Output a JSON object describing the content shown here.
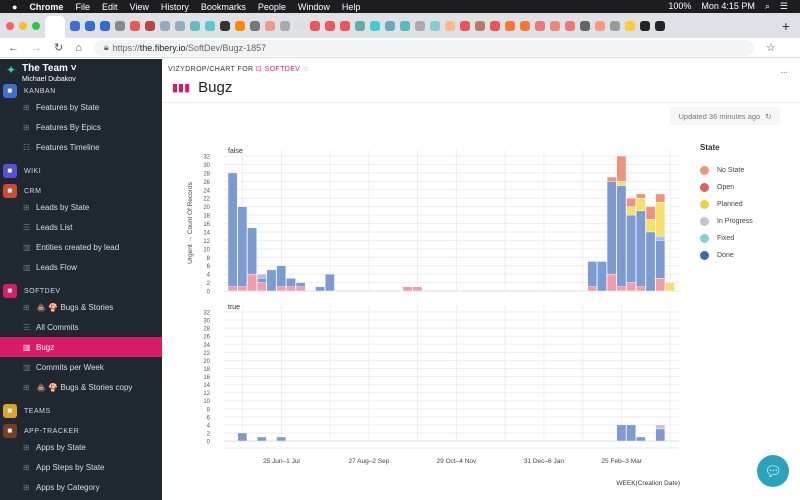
{
  "menubar": {
    "app": "Chrome",
    "items": [
      "File",
      "Edit",
      "View",
      "History",
      "Bookmarks",
      "People",
      "Window",
      "Help"
    ],
    "battery": "100%",
    "clock": "Mon 4:15 PM"
  },
  "browser": {
    "url_prefix": "https://",
    "url_host": "the.fibery.io",
    "url_path": "/SoftDev/Bugz-1857"
  },
  "sidebar": {
    "team": "The Team",
    "user": "Michael Dubakov",
    "sections": [
      {
        "label": "KANBAN",
        "color": "#3a6fd8",
        "items": [
          {
            "label": "Features by State",
            "icon": "board"
          },
          {
            "label": "Features By Epics",
            "icon": "board"
          },
          {
            "label": "Features Timeline",
            "icon": "timeline"
          }
        ]
      },
      {
        "label": "WIKI",
        "color": "#5a4fdc",
        "items": []
      },
      {
        "label": "CRM",
        "color": "#d24a2e",
        "items": [
          {
            "label": "Leads by State",
            "icon": "board"
          },
          {
            "label": "Leads List",
            "icon": "table"
          },
          {
            "label": "Entities created by lead",
            "icon": "chart"
          },
          {
            "label": "Leads Flow",
            "icon": "chart"
          }
        ]
      },
      {
        "label": "SOFTDEV",
        "color": "#da1b69",
        "items": [
          {
            "label": "💩 🍄  Bugs & Stories",
            "icon": "board"
          },
          {
            "label": "All Commits",
            "icon": "table"
          },
          {
            "label": "Bugz",
            "icon": "chart",
            "active": true
          },
          {
            "label": "Commits per Week",
            "icon": "chart"
          },
          {
            "label": "💩 🍄  Bugs & Stories copy",
            "icon": "board"
          }
        ]
      },
      {
        "label": "TEAMS",
        "color": "#e0a22a",
        "items": []
      },
      {
        "label": "APP-TRACKER",
        "color": "#7a3f22",
        "items": [
          {
            "label": "Apps by State",
            "icon": "board"
          },
          {
            "label": "App Steps by State",
            "icon": "board"
          },
          {
            "label": "Apps by Category",
            "icon": "board"
          }
        ]
      }
    ]
  },
  "page": {
    "breadcrumb_prefix": "VIZYDROP/CHART FOR",
    "breadcrumb_space": "SOFTDEV",
    "title": "Bugz",
    "updated": "Updated 36 minutes ago",
    "more": "..."
  },
  "chart_data": {
    "type": "bar",
    "stacked": true,
    "xlabel": "WEEK(Creation Date)",
    "ylabel": "Urgent → Count Of Records",
    "ylim": [
      0,
      32
    ],
    "yticks": [
      0,
      2,
      4,
      6,
      8,
      10,
      12,
      14,
      16,
      18,
      20,
      22,
      24,
      26,
      28,
      30,
      32
    ],
    "x_ticks": [
      {
        "week": 5,
        "label": "25 Jun–1 Jul"
      },
      {
        "week": 14,
        "label": "27 Aug–2 Sep"
      },
      {
        "week": 23,
        "label": "29 Oct–4 Nov"
      },
      {
        "week": 32,
        "label": "31 Dec–6 Jan"
      },
      {
        "week": 40,
        "label": "25 Feb–3 Mar"
      }
    ],
    "weeks_total": 46,
    "legend": {
      "title": "State",
      "placement": "right",
      "entries": [
        {
          "name": "No State",
          "color": "#f0937c"
        },
        {
          "name": "Open",
          "color": "#f59cab"
        },
        {
          "name": "Planned",
          "color": "#f7e06a"
        },
        {
          "name": "In Progress",
          "color": "#c2c5cc"
        },
        {
          "name": "Fixed",
          "color": "#a9c1ea"
        },
        {
          "name": "Done",
          "color": "#7c9bd3"
        }
      ]
    },
    "facets": [
      {
        "label": "false",
        "bars": [
          {
            "week": 0,
            "Open": 1,
            "Done": 27
          },
          {
            "week": 1,
            "Open": 1,
            "Done": 19
          },
          {
            "week": 2,
            "Open": 4,
            "Done": 11
          },
          {
            "week": 3,
            "Open": 2,
            "Done": 1,
            "Fixed": 1
          },
          {
            "week": 4,
            "Done": 5
          },
          {
            "week": 5,
            "Open": 1,
            "Done": 5
          },
          {
            "week": 6,
            "Open": 1,
            "Done": 2
          },
          {
            "week": 7,
            "Open": 1,
            "Done": 1
          },
          {
            "week": 9,
            "Done": 1
          },
          {
            "week": 10,
            "Done": 4
          },
          {
            "week": 18,
            "Open": 1
          },
          {
            "week": 19,
            "Open": 1
          },
          {
            "week": 37,
            "Open": 1,
            "Done": 6
          },
          {
            "week": 38,
            "Done": 7
          },
          {
            "week": 39,
            "Open": 4,
            "Done": 22,
            "No State": 1
          },
          {
            "week": 40,
            "Open": 1,
            "Done": 24,
            "Planned": 1,
            "No State": 6
          },
          {
            "week": 41,
            "Open": 2,
            "Done": 16,
            "Planned": 2,
            "No State": 2
          },
          {
            "week": 42,
            "Open": 1,
            "Done": 18,
            "Planned": 3,
            "No State": 1
          },
          {
            "week": 43,
            "Done": 14,
            "Planned": 3,
            "No State": 3
          },
          {
            "week": 44,
            "Open": 3,
            "Done": 9,
            "Fixed": 1,
            "Planned": 8,
            "No State": 2
          },
          {
            "week": 45,
            "Planned": 2
          }
        ]
      },
      {
        "label": "true",
        "bars": [
          {
            "week": 1,
            "Done": 2
          },
          {
            "week": 3,
            "Done": 1
          },
          {
            "week": 5,
            "Done": 1
          },
          {
            "week": 40,
            "Done": 4
          },
          {
            "week": 41,
            "Done": 4
          },
          {
            "week": 42,
            "Done": 1
          },
          {
            "week": 44,
            "Done": 3,
            "In Progress": 1
          }
        ]
      }
    ]
  }
}
